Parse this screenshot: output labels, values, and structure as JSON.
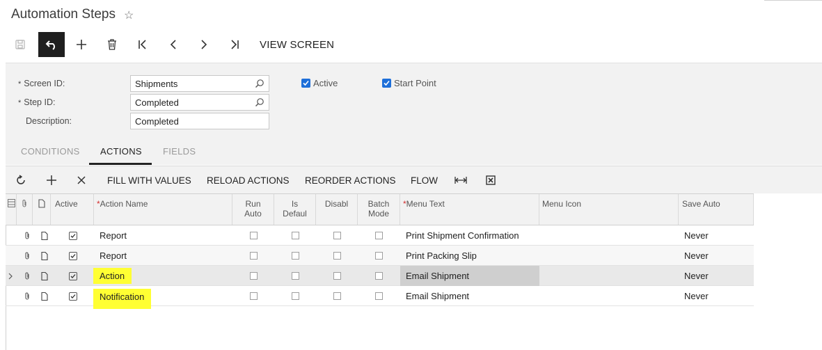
{
  "page": {
    "title": "Automation Steps"
  },
  "toolbar": {
    "view_screen": "VIEW SCREEN"
  },
  "form": {
    "screen_id_label": "Screen ID:",
    "screen_id_value": "Shipments",
    "step_id_label": "Step ID:",
    "step_id_value": "Completed",
    "description_label": "Description:",
    "description_value": "Completed",
    "active_label": "Active",
    "start_point_label": "Start Point",
    "active_checked": true,
    "start_point_checked": true,
    "required_mark": "*"
  },
  "tabs": [
    {
      "label": "CONDITIONS",
      "active": false
    },
    {
      "label": "ACTIONS",
      "active": true
    },
    {
      "label": "FIELDS",
      "active": false
    }
  ],
  "grid_toolbar": {
    "fill_with_values": "FILL WITH VALUES",
    "reload_actions": "RELOAD ACTIONS",
    "reorder_actions": "REORDER ACTIONS",
    "flow": "FLOW"
  },
  "grid": {
    "headers": {
      "active": "Active",
      "action_name": "Action Name",
      "run_auto_1": "Run",
      "run_auto_2": "Auto",
      "is_default_1": "Is",
      "is_default_2": "Defaul",
      "disabled": "Disabl",
      "batch_mode_1": "Batch",
      "batch_mode_2": "Mode",
      "menu_text": "Menu Text",
      "menu_icon": "Menu Icon",
      "save_auto": "Save Auto",
      "required_mark": "*"
    },
    "rows": [
      {
        "active": true,
        "action_name": "Report",
        "menu_text": "Print Shipment Confirmation",
        "save_auto": "Never",
        "highlight": false
      },
      {
        "active": true,
        "action_name": "Report",
        "menu_text": "Print Packing Slip",
        "save_auto": "Never",
        "highlight": false
      },
      {
        "active": true,
        "action_name": "Action",
        "menu_text": "Email Shipment",
        "save_auto": "Never",
        "highlight": true
      },
      {
        "active": true,
        "action_name": "Notification",
        "menu_text": "Email Shipment",
        "save_auto": "Never",
        "highlight": true
      }
    ]
  },
  "colors": {
    "accent": "#1e6fd9",
    "highlight": "#ffff33",
    "dark_button": "#1f1f1f"
  }
}
